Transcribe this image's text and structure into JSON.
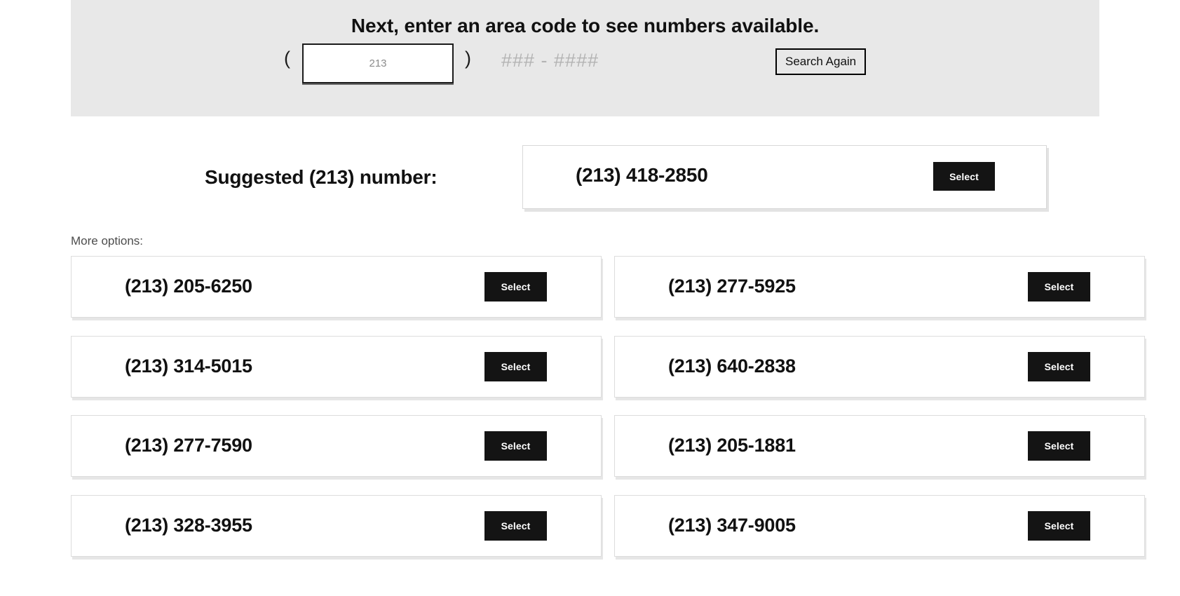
{
  "search_banner": {
    "heading": "Next, enter an area code to see numbers available.",
    "paren_open": "(",
    "paren_close": ")",
    "area_code_value": "",
    "area_code_placeholder": "213",
    "number_mask": "### - ####",
    "search_again_label": "Search Again",
    "background_color": "#e8e8e8"
  },
  "suggested": {
    "label": "Suggested (213) number:",
    "number": "(213) 418-2850",
    "select_label": "Select"
  },
  "more_options": {
    "label": "More options:",
    "select_label": "Select",
    "cards": [
      {
        "number": "(213) 205-6250",
        "select_label": "Select"
      },
      {
        "number": "(213) 277-5925",
        "select_label": "Select"
      },
      {
        "number": "(213) 314-5015",
        "select_label": "Select"
      },
      {
        "number": "(213) 640-2838",
        "select_label": "Select"
      },
      {
        "number": "(213) 277-7590",
        "select_label": "Select"
      },
      {
        "number": "(213) 205-1881",
        "select_label": "Select"
      },
      {
        "number": "(213) 328-3955",
        "select_label": "Select"
      },
      {
        "number": "(213) 347-9005",
        "select_label": "Select"
      }
    ]
  },
  "colors": {
    "accent": "#141414",
    "banner": "#e8e8e8",
    "card_border": "#dddddd",
    "placeholder_text": "#b3b3b3"
  }
}
